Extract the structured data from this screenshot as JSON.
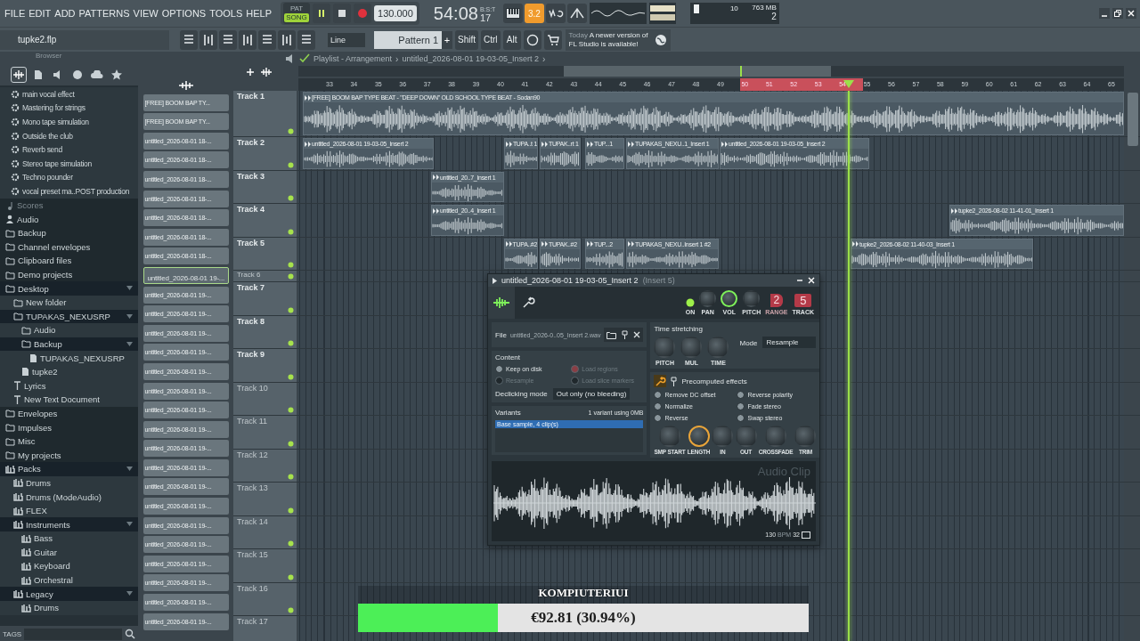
{
  "menu": [
    "FILE",
    "EDIT",
    "ADD",
    "PATTERNS",
    "VIEW",
    "OPTIONS",
    "TOOLS",
    "HELP"
  ],
  "transport": {
    "pat_label": "PAT",
    "song_label": "SONG",
    "song_mode": true,
    "tempo": "130.000",
    "time": "54:08",
    "time_ticks": "17",
    "time_format": "B:S:T",
    "countdown": "3.2"
  },
  "monitor": {
    "cpu": "10",
    "memory": "763 MB",
    "polyphony": "2"
  },
  "project": {
    "filename": "tupke2.flp"
  },
  "toolbar": {
    "snap": "Line",
    "pattern": "Pattern 1",
    "add": "+",
    "modifiers": [
      "Shift",
      "Ctrl",
      "Alt"
    ],
    "news_date": "Today",
    "news": "A newer version of FL Studio is available!"
  },
  "browser": {
    "title": "Browser",
    "tags": "TAGS",
    "tabs": [
      {
        "selected": true
      },
      {
        "selected": false
      },
      {
        "selected": false
      },
      {
        "selected": false
      },
      {
        "selected": false
      },
      {
        "selected": false
      }
    ],
    "items": [
      {
        "label": "main vocal effect",
        "kind": "preset"
      },
      {
        "label": "Mastering for strings",
        "kind": "preset"
      },
      {
        "label": "Mono tape simulation",
        "kind": "preset"
      },
      {
        "label": "Outside the club",
        "kind": "preset"
      },
      {
        "label": "Reverb send",
        "kind": "preset"
      },
      {
        "label": "Stereo tape simulation",
        "kind": "preset"
      },
      {
        "label": "Techno pounder",
        "kind": "preset"
      },
      {
        "label": "vocal preset ma..POST production",
        "kind": "preset"
      },
      {
        "label": "Scores",
        "kind": "note"
      },
      {
        "label": "Audio",
        "kind": "user"
      },
      {
        "label": "Backup",
        "kind": "folder"
      },
      {
        "label": "Channel envelopes",
        "kind": "folder"
      },
      {
        "label": "Clipboard files",
        "kind": "folder"
      },
      {
        "label": "Demo projects",
        "kind": "folder"
      },
      {
        "label": "Desktop",
        "kind": "folder",
        "children": [
          {
            "label": "New folder",
            "kind": "folder"
          },
          {
            "label": "TUPAKAS_NEXUSRP",
            "kind": "folder",
            "children": [
              {
                "label": "Audio",
                "kind": "folder"
              },
              {
                "label": "Backup",
                "kind": "folder",
                "children": [
                  {
                    "label": "TUPAKAS_NEXUSRP",
                    "kind": "file"
                  }
                ]
              },
              {
                "label": "tupke2",
                "kind": "file"
              }
            ]
          },
          {
            "label": "Lyrics",
            "kind": "text"
          },
          {
            "label": "New Text Document",
            "kind": "text"
          }
        ]
      },
      {
        "label": "Envelopes",
        "kind": "folder"
      },
      {
        "label": "Impulses",
        "kind": "folder"
      },
      {
        "label": "Misc",
        "kind": "folder"
      },
      {
        "label": "My projects",
        "kind": "folder"
      },
      {
        "label": "Packs",
        "kind": "pack",
        "children": [
          {
            "label": "Drums",
            "kind": "pack"
          },
          {
            "label": "Drums (ModeAudio)",
            "kind": "pack"
          },
          {
            "label": "FLEX",
            "kind": "pack"
          },
          {
            "label": "Instruments",
            "kind": "pack",
            "children": [
              {
                "label": "Bass",
                "kind": "pack"
              },
              {
                "label": "Guitar",
                "kind": "pack"
              },
              {
                "label": "Keyboard",
                "kind": "pack"
              },
              {
                "label": "Orchestral",
                "kind": "pack"
              }
            ]
          },
          {
            "label": "Legacy",
            "kind": "pack",
            "children": [
              {
                "label": "Drums",
                "kind": "pack"
              }
            ]
          }
        ]
      }
    ]
  },
  "clip_list": [
    {
      "label": "[FREE] BOOM BAP TY...",
      "selected": false
    },
    {
      "label": "[FREE] BOOM BAP TY...",
      "selected": false
    },
    {
      "label": "untitled_2026-08-01 18-...",
      "selected": false
    },
    {
      "label": "untitled_2026-08-01 18-...",
      "selected": false
    },
    {
      "label": "untitled_2026-08-01 18-...",
      "selected": false
    },
    {
      "label": "untitled_2026-08-01 18-...",
      "selected": false
    },
    {
      "label": "untitled_2026-08-01 18-...",
      "selected": false
    },
    {
      "label": "untitled_2026-08-01 18-...",
      "selected": false
    },
    {
      "label": "untitled_2026-08-01 18-...",
      "selected": false
    },
    {
      "label": "untitled_2026-08-01 19-...",
      "selected": true
    },
    {
      "label": "untitled_2026-08-01 19-...",
      "selected": false
    },
    {
      "label": "untitled_2026-08-01 19-...",
      "selected": false
    },
    {
      "label": "untitled_2026-08-01 19-...",
      "selected": false
    },
    {
      "label": "untitled_2026-08-01 19-...",
      "selected": false
    },
    {
      "label": "untitled_2026-08-01 19-...",
      "selected": false
    },
    {
      "label": "untitled_2026-08-01 19-...",
      "selected": false
    },
    {
      "label": "untitled_2026-08-01 19-...",
      "selected": false
    },
    {
      "label": "untitled_2026-08-01 19-...",
      "selected": false
    },
    {
      "label": "untitled_2026-08-01 19-...",
      "selected": false
    },
    {
      "label": "untitled_2026-08-01 19-...",
      "selected": false
    },
    {
      "label": "untitled_2026-08-01 19-...",
      "selected": false
    },
    {
      "label": "untitled_2026-08-01 19-...",
      "selected": false
    },
    {
      "label": "untitled_2026-08-01 19-...",
      "selected": false
    },
    {
      "label": "untitled_2026-08-01 19-...",
      "selected": false
    },
    {
      "label": "untitled_2026-08-01 19-...",
      "selected": false
    },
    {
      "label": "untitled_2026-08-01 19-...",
      "selected": false
    },
    {
      "label": "untitled_2026-08-01 19-...",
      "selected": false
    },
    {
      "label": "untitled_2026-08-01 19-...",
      "selected": false
    }
  ],
  "playlist": {
    "path": [
      "Playlist - Arrangement",
      "untitled_2026-08-01 19-03-05_Insert 2"
    ],
    "separator": "›",
    "ruler": [
      {
        "label": "33",
        "selected": false
      },
      {
        "label": "34",
        "selected": false
      },
      {
        "label": "35",
        "selected": false
      },
      {
        "label": "36",
        "selected": false
      },
      {
        "label": "37",
        "selected": false
      },
      {
        "label": "38",
        "selected": false
      },
      {
        "label": "39",
        "selected": false
      },
      {
        "label": "40",
        "selected": false
      },
      {
        "label": "41",
        "selected": false
      },
      {
        "label": "42",
        "selected": false
      },
      {
        "label": "43",
        "selected": false
      },
      {
        "label": "44",
        "selected": false
      },
      {
        "label": "45",
        "selected": false
      },
      {
        "label": "46",
        "selected": false
      },
      {
        "label": "47",
        "selected": false
      },
      {
        "label": "48",
        "selected": false
      },
      {
        "label": "49",
        "selected": false
      },
      {
        "label": "50",
        "selected": true
      },
      {
        "label": "51",
        "selected": true
      },
      {
        "label": "52",
        "selected": true
      },
      {
        "label": "53",
        "selected": true
      },
      {
        "label": "54",
        "selected": true
      },
      {
        "label": "55",
        "selected": false
      },
      {
        "label": "56",
        "selected": false
      },
      {
        "label": "57",
        "selected": false
      },
      {
        "label": "58",
        "selected": false
      },
      {
        "label": "59",
        "selected": false
      },
      {
        "label": "60",
        "selected": false
      },
      {
        "label": "61",
        "selected": false
      },
      {
        "label": "62",
        "selected": false
      },
      {
        "label": "63",
        "selected": false
      },
      {
        "label": "64",
        "selected": false
      },
      {
        "label": "65",
        "selected": false
      }
    ],
    "tracks": [
      {
        "name": "Track 1",
        "dimmed": false,
        "collapsed": false,
        "clips": [
          {
            "label": "[FREE] BOOM BAP TYPE BEAT - \"DEEP DOWN\" OLD SCHOOL TYPE BEAT - Sodan90"
          }
        ]
      },
      {
        "name": "Track 2",
        "dimmed": false,
        "collapsed": false,
        "clips": [
          {
            "label": "untitled_2026-08-01 19-03-05_Insert 2"
          },
          {
            "label": "TUPA..t 1"
          },
          {
            "label": "TUPAK..rt 1"
          },
          {
            "label": "TUP...1"
          },
          {
            "label": "TUPAKAS_NEXU..1_Insert 1"
          },
          {
            "label": "untitled_2026-08-01 19-03-05_Insert 2"
          }
        ]
      },
      {
        "name": "Track 3",
        "dimmed": false,
        "collapsed": false,
        "clips": [
          {
            "label": "untitled_20..7_Insert 1"
          }
        ]
      },
      {
        "name": "Track 4",
        "dimmed": false,
        "collapsed": false,
        "clips": [
          {
            "label": "untitled_20..4_Insert 1"
          },
          {
            "label": "tupke2_2026-08-02 11-41-01_Insert 1"
          }
        ]
      },
      {
        "name": "Track 5",
        "dimmed": false,
        "collapsed": false,
        "clips": [
          {
            "label": "TUPA..#2"
          },
          {
            "label": "TUPAK..#2"
          },
          {
            "label": "TUP...2"
          },
          {
            "label": "TUPAKAS_NEXU..Insert 1 #2"
          },
          {
            "label": "tupke2_2026-08-02 11-40-03_Insert 1"
          }
        ]
      },
      {
        "name": "Track 6",
        "dimmed": true,
        "collapsed": true
      },
      {
        "name": "Track 7",
        "dimmed": false,
        "collapsed": false
      },
      {
        "name": "Track 8",
        "dimmed": false,
        "collapsed": false
      },
      {
        "name": "Track 9",
        "dimmed": false,
        "collapsed": false
      },
      {
        "name": "Track 10",
        "dimmed": true,
        "collapsed": false
      },
      {
        "name": "Track 11",
        "dimmed": true,
        "collapsed": false
      },
      {
        "name": "Track 12",
        "dimmed": true,
        "collapsed": false
      },
      {
        "name": "Track 13",
        "dimmed": true,
        "collapsed": false
      },
      {
        "name": "Track 14",
        "dimmed": true,
        "collapsed": false
      },
      {
        "name": "Track 15",
        "dimmed": true,
        "collapsed": false
      },
      {
        "name": "Track 16",
        "dimmed": true,
        "collapsed": false
      },
      {
        "name": "Track 17",
        "dimmed": true,
        "collapsed": false
      }
    ]
  },
  "clip_window": {
    "title": "untitled_2026-08-01 19-03-05_Insert 2",
    "insert": "(Insert 5)",
    "on": true,
    "on_label": "ON",
    "knobs": [
      {
        "label": "PAN",
        "selected": false
      },
      {
        "label": "VOL",
        "selected": true
      },
      {
        "label": "PITCH",
        "selected": false
      }
    ],
    "range": "2",
    "range_label": "RANGE",
    "track": "5",
    "track_label": "TRACK",
    "file_label": "File",
    "file": "untitled_2026-0..05_Insert 2.wav",
    "content_title": "Content",
    "content_options": [
      {
        "label": "Keep on disk",
        "checked": false,
        "disabled": false
      },
      {
        "label": "Load regions",
        "checked": true,
        "disabled": true
      },
      {
        "label": "Resample",
        "checked": false,
        "disabled": true
      },
      {
        "label": "Load slice markers",
        "checked": false,
        "disabled": true
      }
    ],
    "declicking_label": "Declicking mode",
    "declicking": "Out only (no bleeding)",
    "variants_title": "Variants",
    "variants_info": "1 variant using 0MB",
    "variants": [
      {
        "label": "Base sample, 4 clip(s)",
        "selected": true
      }
    ],
    "stretch_title": "Time stretching",
    "stretch_knobs": [
      {
        "label": "PITCH",
        "selected": false
      },
      {
        "label": "MUL",
        "selected": false
      },
      {
        "label": "TIME",
        "selected": false
      }
    ],
    "mode_label": "Mode",
    "mode": "Resample",
    "effects_title": "Precomputed effects",
    "effects": [
      {
        "label": "Remove DC offset",
        "checked": false
      },
      {
        "label": "Reverse polarity",
        "checked": false
      },
      {
        "label": "Normalize",
        "checked": false
      },
      {
        "label": "Fade stereo",
        "checked": false
      },
      {
        "label": "Reverse",
        "checked": false
      },
      {
        "label": "Swap stereo",
        "checked": false
      }
    ],
    "effect_knobs": [
      {
        "label": "SMP START",
        "selected": false
      },
      {
        "label": "LENGTH",
        "selected": true
      },
      {
        "label": "IN",
        "selected": false
      },
      {
        "label": "OUT",
        "selected": false
      },
      {
        "label": "CROSSFADE",
        "selected": false
      },
      {
        "label": "TRIM",
        "selected": false
      }
    ],
    "preview_label": "Audio Clip",
    "bpm": "130",
    "bpm_unit": "BPM",
    "beats": "32"
  },
  "overlay": {
    "title": "KOMPIUTERIUI",
    "level": 0.3094,
    "amount": "€92.81 (30.94%)"
  }
}
